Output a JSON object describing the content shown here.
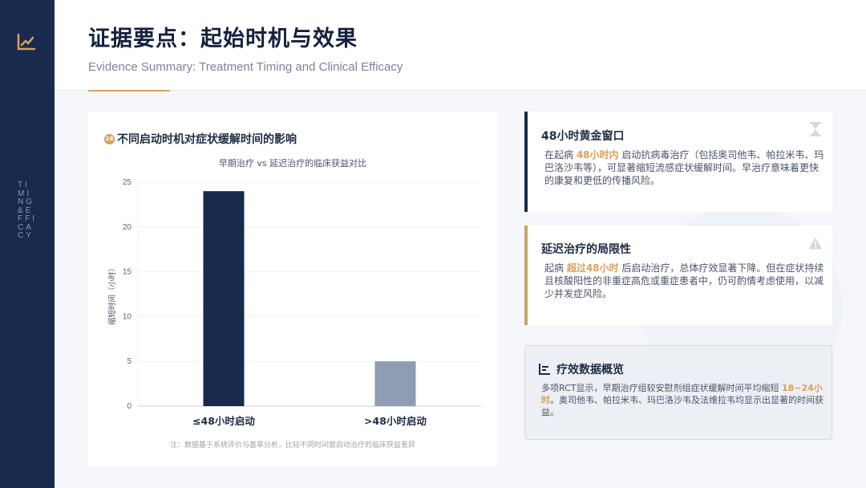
{
  "header": {
    "title": "证据要点：起始时机与效果",
    "subtitle": "Evidence Summary: Treatment Timing and Clinical Efficacy"
  },
  "sidebar": {
    "icon": "line-chart-icon",
    "vertical_text": "TIMING&EFFICACY"
  },
  "chart_card": {
    "heading": "不同启动时机对症状缓解时间的影响",
    "heading_icon_text": "28"
  },
  "chart_data": {
    "type": "bar",
    "title": "早期治疗 vs 延迟治疗的临床获益对比",
    "categories": [
      "≤48小时启动",
      ">48小时启动"
    ],
    "values": [
      24,
      5
    ],
    "colors": [
      "#182a4d",
      "#8e9db3"
    ],
    "ylabel": "缩短时间（小时）",
    "ylim": [
      0,
      25
    ],
    "yticks": [
      0,
      5,
      10,
      15,
      20,
      25
    ],
    "grid": true,
    "note": "注：数据基于系统评价与荟萃分析，比较不同时间窗启动治疗的临床获益差异"
  },
  "cards": {
    "golden_window": {
      "title": "48小时黄金窗口",
      "body_pre": "在起病 ",
      "body_highlight": "48小时内",
      "body_post": " 启动抗病毒治疗（包括奥司他韦、帕拉米韦、玛巴洛沙韦等），可显著缩短流感症状缓解时间。早治疗意味着更快的康复和更低的传播风险。",
      "icon": "hourglass-icon"
    },
    "delayed": {
      "title": "延迟治疗的局限性",
      "body_pre": "起病 ",
      "body_highlight": "超过48小时",
      "body_post": " 后启动治疗，总体疗效显著下降。但在症状持续且核酸阳性的非重症高危或重症患者中，仍可酌情考虑使用，以减少并发症风险。",
      "icon": "warning-icon"
    },
    "stats": {
      "title": "疗效数据概览",
      "body_pre": "多项RCT显示，早期治疗组较安慰剂组症状缓解时间平均缩短 ",
      "body_highlight": "18~24小时",
      "body_post": "。奥司他韦、帕拉米韦、玛巴洛沙韦及法维拉韦均显示出显著的时间获益。",
      "icon": "bar-stats-icon"
    }
  }
}
